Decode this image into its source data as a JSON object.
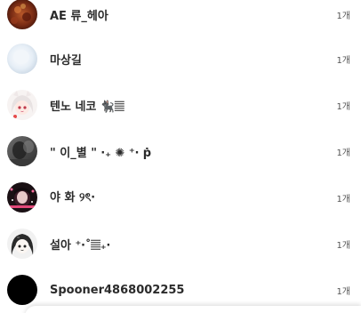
{
  "rows": [
    {
      "name": "AE 류_헤아",
      "count": "1개",
      "avatar": "dark-red-texture-avatar"
    },
    {
      "name": "마상길",
      "count": "1개",
      "avatar": "pale-blue-avatar"
    },
    {
      "name": "텐노 네코 🐈‍⬛𝄚",
      "count": "1개",
      "avatar": "anime-girl-avatar"
    },
    {
      "name": "\" 이_별 \" ‧₊ ✺ ⁺‧ ṗ",
      "count": "1개",
      "avatar": "grayscale-photo-avatar"
    },
    {
      "name": "야 화 ୨ৎ‧",
      "count": "1개",
      "avatar": "dark-pink-avatar"
    },
    {
      "name": "설아 ⁺‧˚𝄚₊‧",
      "count": "1개",
      "avatar": "sketch-girl-avatar"
    },
    {
      "name": "Spooner4868002255",
      "count": "1개",
      "avatar": "black-avatar"
    }
  ]
}
